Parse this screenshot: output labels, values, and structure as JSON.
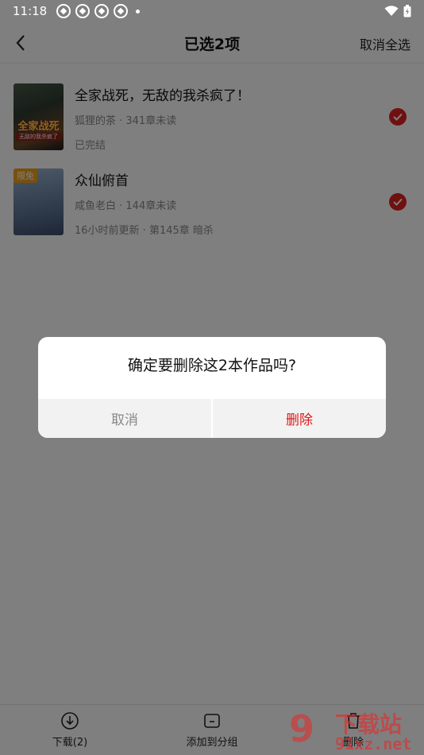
{
  "status_bar": {
    "time": "11:18"
  },
  "header": {
    "title": "已选2项",
    "cancel_all": "取消全选"
  },
  "books": [
    {
      "title": "全家战死，无敌的我杀疯了！",
      "meta": "狐狸的茶 · 341章未读",
      "status": "已完结",
      "cover_text": "全家战死",
      "cover_sub": "无敌的我杀疯了"
    },
    {
      "title": "众仙俯首",
      "meta": "咸鱼老白 · 144章未读",
      "status": "16小时前更新 · 第145章 暗杀",
      "badge": "限免"
    }
  ],
  "bottom_bar": {
    "download": "下载(2)",
    "add_group": "添加到分组",
    "delete": "删除"
  },
  "dialog": {
    "message": "确定要删除这2本作品吗?",
    "cancel": "取消",
    "confirm": "删除"
  },
  "watermark": {
    "logo": "9",
    "name": "下载站",
    "domain": "91xz.net"
  },
  "colors": {
    "accent": "#e02020",
    "overlay": "rgba(0,0,0,0.5)"
  }
}
